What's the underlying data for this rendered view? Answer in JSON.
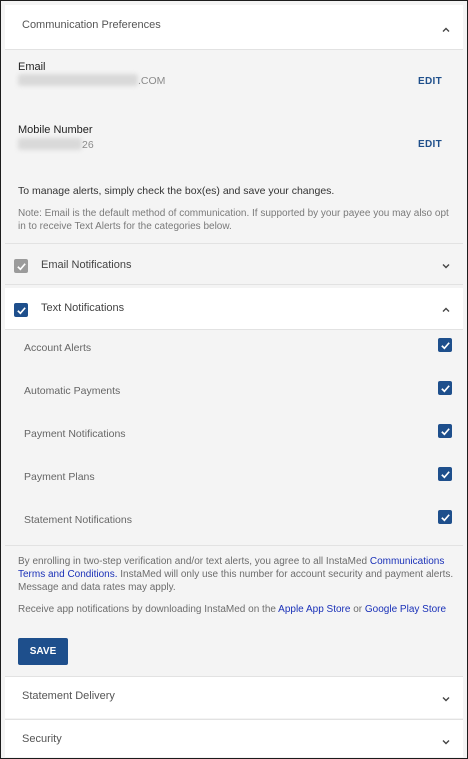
{
  "header": {
    "title": "Communication Preferences"
  },
  "email": {
    "label": "Email",
    "value_suffix": ".COM",
    "edit_label": "EDIT"
  },
  "mobile": {
    "label": "Mobile Number",
    "value_suffix": "26",
    "edit_label": "EDIT"
  },
  "instructions": {
    "manage": "To manage alerts, simply check the box(es) and save your changes.",
    "note": "Note: Email is the default method of communication. If supported by your payee you may also opt in to receive Text Alerts for the categories below."
  },
  "email_notifications": {
    "label": "Email Notifications",
    "checked": true
  },
  "text_notifications": {
    "label": "Text Notifications",
    "checked": true,
    "items": [
      {
        "label": "Account Alerts",
        "checked": true
      },
      {
        "label": "Automatic Payments",
        "checked": true
      },
      {
        "label": "Payment Notifications",
        "checked": true
      },
      {
        "label": "Payment Plans",
        "checked": true
      },
      {
        "label": "Statement Notifications",
        "checked": true
      }
    ]
  },
  "consent": {
    "part1": "By enrolling in two-step verification and/or text alerts, you agree to all InstaMed ",
    "link": "Communications Terms and Conditions.",
    "part2": " InstaMed will only use this number for account security and payment alerts. Message and data rates may apply."
  },
  "apps": {
    "part1": "Receive app notifications by downloading InstaMed on the ",
    "apple_link": "Apple App Store",
    "or": " or ",
    "google_link": "Google Play Store"
  },
  "save_label": "SAVE",
  "statement_delivery": {
    "label": "Statement Delivery"
  },
  "security": {
    "label": "Security"
  },
  "colors": {
    "accent": "#1e4f8c",
    "link": "#1a31b8",
    "disabled_check": "#9b9b9b"
  }
}
